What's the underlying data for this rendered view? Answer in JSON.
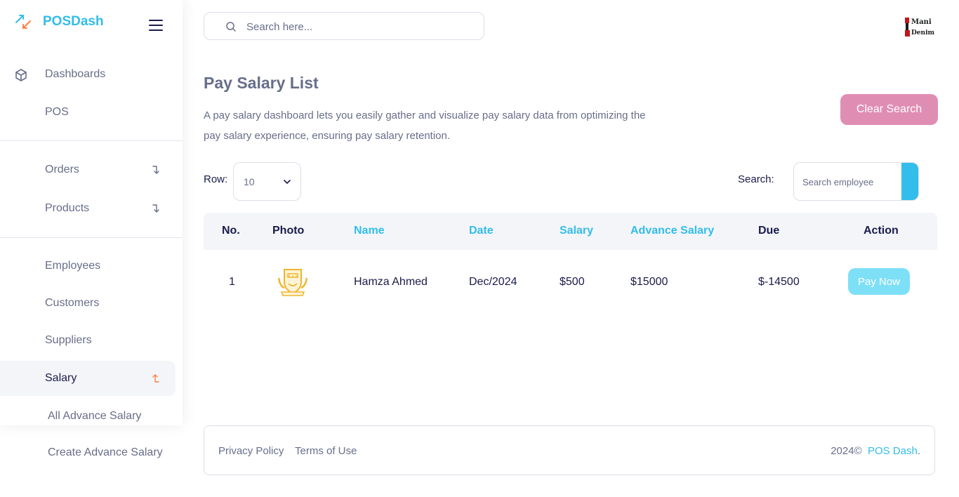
{
  "brand": {
    "name": "POSDash"
  },
  "search": {
    "placeholder": "Search here..."
  },
  "sidebar": {
    "items": [
      {
        "label": "Dashboards"
      },
      {
        "label": "POS"
      },
      {
        "label": "Orders"
      },
      {
        "label": "Products"
      },
      {
        "label": "Employees"
      },
      {
        "label": "Customers"
      },
      {
        "label": "Suppliers"
      },
      {
        "label": "Salary"
      }
    ],
    "sub_items": [
      {
        "label": "All Advance Salary"
      },
      {
        "label": "Create Advance Salary"
      }
    ]
  },
  "page": {
    "title": "Pay Salary List",
    "description": "A pay salary dashboard lets you easily gather and visualize pay salary data from optimizing the pay salary experience, ensuring pay salary retention.",
    "clear_button": "Clear Search",
    "row_label": "Row:",
    "row_value": "10",
    "search_label": "Search:",
    "search_placeholder": "Search employee"
  },
  "table": {
    "headers": [
      "No.",
      "Photo",
      "Name",
      "Date",
      "Salary",
      "Advance Salary",
      "Due",
      "Action"
    ],
    "rows": [
      {
        "no": "1",
        "name": "Hamza Ahmed",
        "date": "Dec/2024",
        "salary": "$500",
        "advance": "$15000",
        "due": "$-14500",
        "action": "Pay Now"
      }
    ]
  },
  "footer": {
    "privacy": "Privacy Policy",
    "terms": "Terms of Use",
    "copyright": "2024©",
    "brand_link": "POS Dash",
    "period": "."
  },
  "logo_text": {
    "line1": "Mani",
    "line2": "Denim"
  },
  "colors": {
    "accent": "#32bdea",
    "clear_button": "#e08db4",
    "pay_button": "#7ee0f7",
    "heading": "#1a1b4b",
    "text": "#676e8a"
  }
}
